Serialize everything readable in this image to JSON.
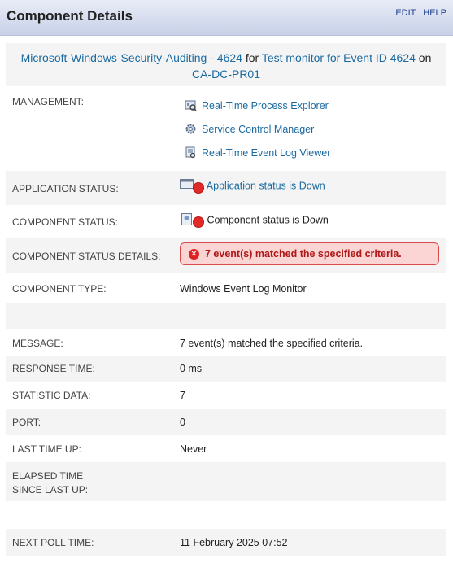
{
  "header": {
    "title": "Component Details",
    "edit": "EDIT",
    "help": "HELP"
  },
  "summary": {
    "component_link": "Microsoft-Windows-Security-Auditing - 4624",
    "for_text": "for",
    "monitor_link": "Test monitor for Event ID 4624",
    "on_text": "on",
    "node_link": "CA-DC-PR01"
  },
  "management": {
    "label": "MANAGEMENT:",
    "items": [
      "Real-Time Process Explorer",
      "Service Control Manager",
      "Real-Time Event Log Viewer"
    ]
  },
  "application_status": {
    "label": "APPLICATION STATUS:",
    "value": "Application status is Down",
    "color": "#e02a2a"
  },
  "component_status": {
    "label": "COMPONENT STATUS:",
    "value": "Component status is Down"
  },
  "component_status_details": {
    "label": "COMPONENT STATUS DETAILS:",
    "value": "7 event(s) matched the specified criteria."
  },
  "component_type": {
    "label": "COMPONENT TYPE:",
    "value": "Windows Event Log Monitor"
  },
  "message": {
    "label": "MESSAGE:",
    "value": "7 event(s) matched the specified criteria."
  },
  "response_time": {
    "label": "RESPONSE TIME:",
    "value": "0 ms"
  },
  "statistic_data": {
    "label": "STATISTIC DATA:",
    "value": "7"
  },
  "port": {
    "label": "PORT:",
    "value": "0"
  },
  "last_time_up": {
    "label": "LAST TIME UP:",
    "value": "Never"
  },
  "elapsed_time": {
    "label_line1": "ELAPSED TIME",
    "label_line2": "SINCE LAST UP:",
    "value": ""
  },
  "next_poll_time": {
    "label": "NEXT POLL TIME:",
    "value": "11 February 2025 07:52"
  }
}
